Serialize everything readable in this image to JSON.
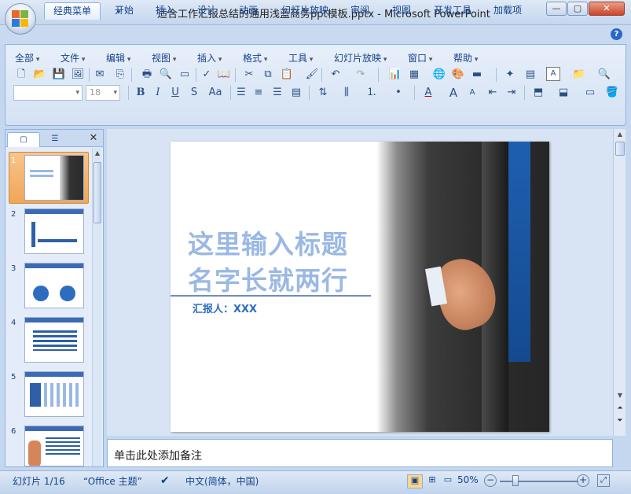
{
  "window": {
    "title": "适合工作汇报总结的通用浅蓝商务ppt模板.pptx - Microsoft PowerPoint",
    "minimize": "—",
    "restore": "▢",
    "close": "✕"
  },
  "quick_access": [
    "save-icon",
    "undo-icon",
    "redo-icon",
    "customize-icon"
  ],
  "tabs": [
    "经典菜单",
    "开始",
    "插入",
    "设计",
    "动画",
    "幻灯片放映",
    "审阅",
    "视图",
    "开发工具",
    "加载项"
  ],
  "active_tab": "经典菜单",
  "help": "?",
  "menus": [
    "全部",
    "文件",
    "编辑",
    "视图",
    "插入",
    "格式",
    "工具",
    "幻灯片放映",
    "窗口",
    "帮助"
  ],
  "font_box": {
    "name": "",
    "size": "18"
  },
  "format_buttons": {
    "bold": "B",
    "italic": "I",
    "underline": "U",
    "shadow": "S",
    "aa": "Aa"
  },
  "slides": [
    {
      "num": "1"
    },
    {
      "num": "2"
    },
    {
      "num": "3"
    },
    {
      "num": "4"
    },
    {
      "num": "5"
    },
    {
      "num": "6"
    }
  ],
  "slide": {
    "title_line1": "这里输入标题",
    "title_line2": "名字长就两行",
    "reporter": "汇报人：XXX",
    "accent_color": "#9ab8e4",
    "reporter_color": "#2e6cc0"
  },
  "notes_placeholder": "单击此处添加备注",
  "status": {
    "slide_info": "幻灯片 1/16",
    "theme": "“Office 主题”",
    "language": "中文(简体，中国)",
    "zoom": "50%"
  }
}
